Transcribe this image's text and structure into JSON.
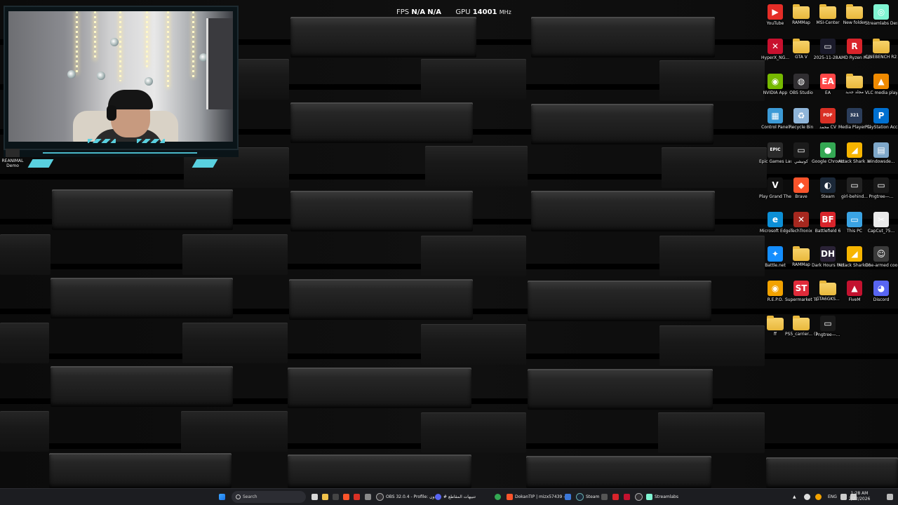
{
  "overlay": {
    "fps_label": "FPS",
    "fps_value_1": "N/A",
    "fps_value_2": "N/A",
    "gpu_label": "GPU",
    "gpu_value": "14001",
    "gpu_unit": "MHz"
  },
  "webcam_desktop_icon": {
    "label": "REANIMAL Demo"
  },
  "desktop_icons": [
    {
      "label": "YouTube",
      "icon": "youtube-icon",
      "color": "#e52d27",
      "glyph": "▶"
    },
    {
      "label": "RAMMap",
      "icon": "folder-icon",
      "color": "#e9b83c",
      "glyph": ""
    },
    {
      "label": "MSI-Center",
      "icon": "folder-icon",
      "color": "#e9b83c",
      "glyph": ""
    },
    {
      "label": "New folder",
      "icon": "folder-icon",
      "color": "#e9b83c",
      "glyph": ""
    },
    {
      "label": "Streamlabs Desktop",
      "icon": "streamlabs-icon",
      "color": "#80f5d2",
      "glyph": "◎"
    },
    {
      "label": "HyperX_NG...",
      "icon": "hyperx-icon",
      "color": "#c8102e",
      "glyph": "✕"
    },
    {
      "label": "GTA V",
      "icon": "folder-icon",
      "color": "#e9b83c",
      "glyph": ""
    },
    {
      "label": "2025-11-28...",
      "icon": "video-file-icon",
      "color": "#1a1a2a",
      "glyph": "▭"
    },
    {
      "label": "AMD Ryzen Master",
      "icon": "amd-icon",
      "color": "#d9232a",
      "glyph": "R"
    },
    {
      "label": "CINEBENCH R23",
      "icon": "folder-icon",
      "color": "#e9b83c",
      "glyph": ""
    },
    {
      "label": "NVIDIA App",
      "icon": "nvidia-icon",
      "color": "#76b900",
      "glyph": "◉"
    },
    {
      "label": "OBS Studio",
      "icon": "obs-icon",
      "color": "#302e31",
      "glyph": "◍"
    },
    {
      "label": "EA",
      "icon": "ea-icon",
      "color": "#ff4747",
      "glyph": "EA"
    },
    {
      "label": "مجلد جديد",
      "icon": "folder-icon",
      "color": "#e9b83c",
      "glyph": ""
    },
    {
      "label": "VLC media player",
      "icon": "vlc-icon",
      "color": "#f08a00",
      "glyph": "▲"
    },
    {
      "label": "Control Panel",
      "icon": "control-panel-icon",
      "color": "#3c9ad6",
      "glyph": "▦"
    },
    {
      "label": "Recycle Bin",
      "icon": "recycle-bin-icon",
      "color": "#8fb5d9",
      "glyph": "♻"
    },
    {
      "label": "محمد CV",
      "icon": "pdf-icon",
      "color": "#d93025",
      "glyph": "PDF"
    },
    {
      "label": "Media Player Classic",
      "icon": "mpc-icon",
      "color": "#2b3d5a",
      "glyph": "321"
    },
    {
      "label": "PlayStation Accessories",
      "icon": "playstation-icon",
      "color": "#0070d1",
      "glyph": "P"
    },
    {
      "label": "Epic Games Launcher",
      "icon": "epic-icon",
      "color": "#2a2a2a",
      "glyph": "EPIC"
    },
    {
      "label": "كونيشي",
      "icon": "image-file-icon",
      "color": "#1b1b1b",
      "glyph": "▭"
    },
    {
      "label": "Google Chrome",
      "icon": "chrome-icon",
      "color": "#34a853",
      "glyph": "●"
    },
    {
      "label": "Attack Shark X85Keyboard",
      "icon": "attack-shark-icon",
      "color": "#f7b500",
      "glyph": "◢"
    },
    {
      "label": "windowsde...",
      "icon": "windows-file-icon",
      "color": "#7ea7c9",
      "glyph": "▤"
    },
    {
      "label": "Play Grand Theft Auto...",
      "icon": "gta-icon",
      "color": "#111",
      "glyph": "V"
    },
    {
      "label": "Brave",
      "icon": "brave-icon",
      "color": "#fb542b",
      "glyph": "◆"
    },
    {
      "label": "Steam",
      "icon": "steam-icon",
      "color": "#1b2838",
      "glyph": "◐"
    },
    {
      "label": "girl-behind...",
      "icon": "image-file-icon",
      "color": "#222",
      "glyph": "▭"
    },
    {
      "label": "Pngtree—...",
      "icon": "png-file-icon",
      "color": "#1a1a1a",
      "glyph": "▭"
    },
    {
      "label": "Microsoft Edge",
      "icon": "edge-icon",
      "color": "#0c8fd6",
      "glyph": "e"
    },
    {
      "label": "TechTronix",
      "icon": "techtronix-icon",
      "color": "#a6281f",
      "glyph": "✕"
    },
    {
      "label": "Battlefield 6",
      "icon": "battlefield-icon",
      "color": "#d8242b",
      "glyph": "BF"
    },
    {
      "label": "This PC",
      "icon": "this-pc-icon",
      "color": "#3aa3e3",
      "glyph": "▭"
    },
    {
      "label": "CapCut_75...",
      "icon": "capcut-icon",
      "color": "#eaeaea",
      "glyph": "✂"
    },
    {
      "label": "Battle.net",
      "icon": "battlenet-icon",
      "color": "#148eff",
      "glyph": "✦"
    },
    {
      "label": "RAMMap",
      "icon": "folder-icon",
      "color": "#e9b83c",
      "glyph": ""
    },
    {
      "label": "Dark Hours Prologue",
      "icon": "dark-hours-icon",
      "color": "#2a2236",
      "glyph": "DH"
    },
    {
      "label": "Attack SharkX8M...",
      "icon": "attack-shark-icon",
      "color": "#f7b500",
      "glyph": "◢"
    },
    {
      "label": "One-armed cook",
      "icon": "one-armed-cook-icon",
      "color": "#3b3b3b",
      "glyph": "☺"
    },
    {
      "label": "R.E.P.O.",
      "icon": "repo-icon",
      "color": "#f2a200",
      "glyph": "◉"
    },
    {
      "label": "Supermarket Together",
      "icon": "supermarket-icon",
      "color": "#e02b3a",
      "glyph": "ST"
    },
    {
      "label": "GTA6GKS...",
      "icon": "folder-icon",
      "color": "#e9b83c",
      "glyph": ""
    },
    {
      "label": "FiveM",
      "icon": "fivem-icon",
      "color": "#c3122f",
      "glyph": "▲"
    },
    {
      "label": "Discord",
      "icon": "discord-icon",
      "color": "#5865f2",
      "glyph": "◕"
    },
    {
      "label": "ff",
      "icon": "folder-icon",
      "color": "#e9b83c",
      "glyph": ""
    },
    {
      "label": "PS5_carrier... (1)",
      "icon": "folder-icon",
      "color": "#e9b83c",
      "glyph": ""
    },
    {
      "label": "Pngtree—...",
      "icon": "png-file-icon",
      "color": "#1a1a1a",
      "glyph": "▭"
    }
  ],
  "taskbar": {
    "search_placeholder": "Search",
    "apps": [
      {
        "label": "OBS 32.0.4 - Profile: بدون",
        "icon": "obs-icon"
      },
      {
        "label": "# تنبيهات المقاطع",
        "icon": "discord-icon"
      },
      {
        "label": "DokanTIP | mizx57439 -",
        "icon": "brave-icon"
      },
      {
        "label": "Steam",
        "icon": "steam-icon"
      },
      {
        "label": "Streamlabs",
        "icon": "streamlabs-icon"
      }
    ],
    "language": "ENG",
    "time": "1:28 AM",
    "date": "2/22/2026"
  }
}
